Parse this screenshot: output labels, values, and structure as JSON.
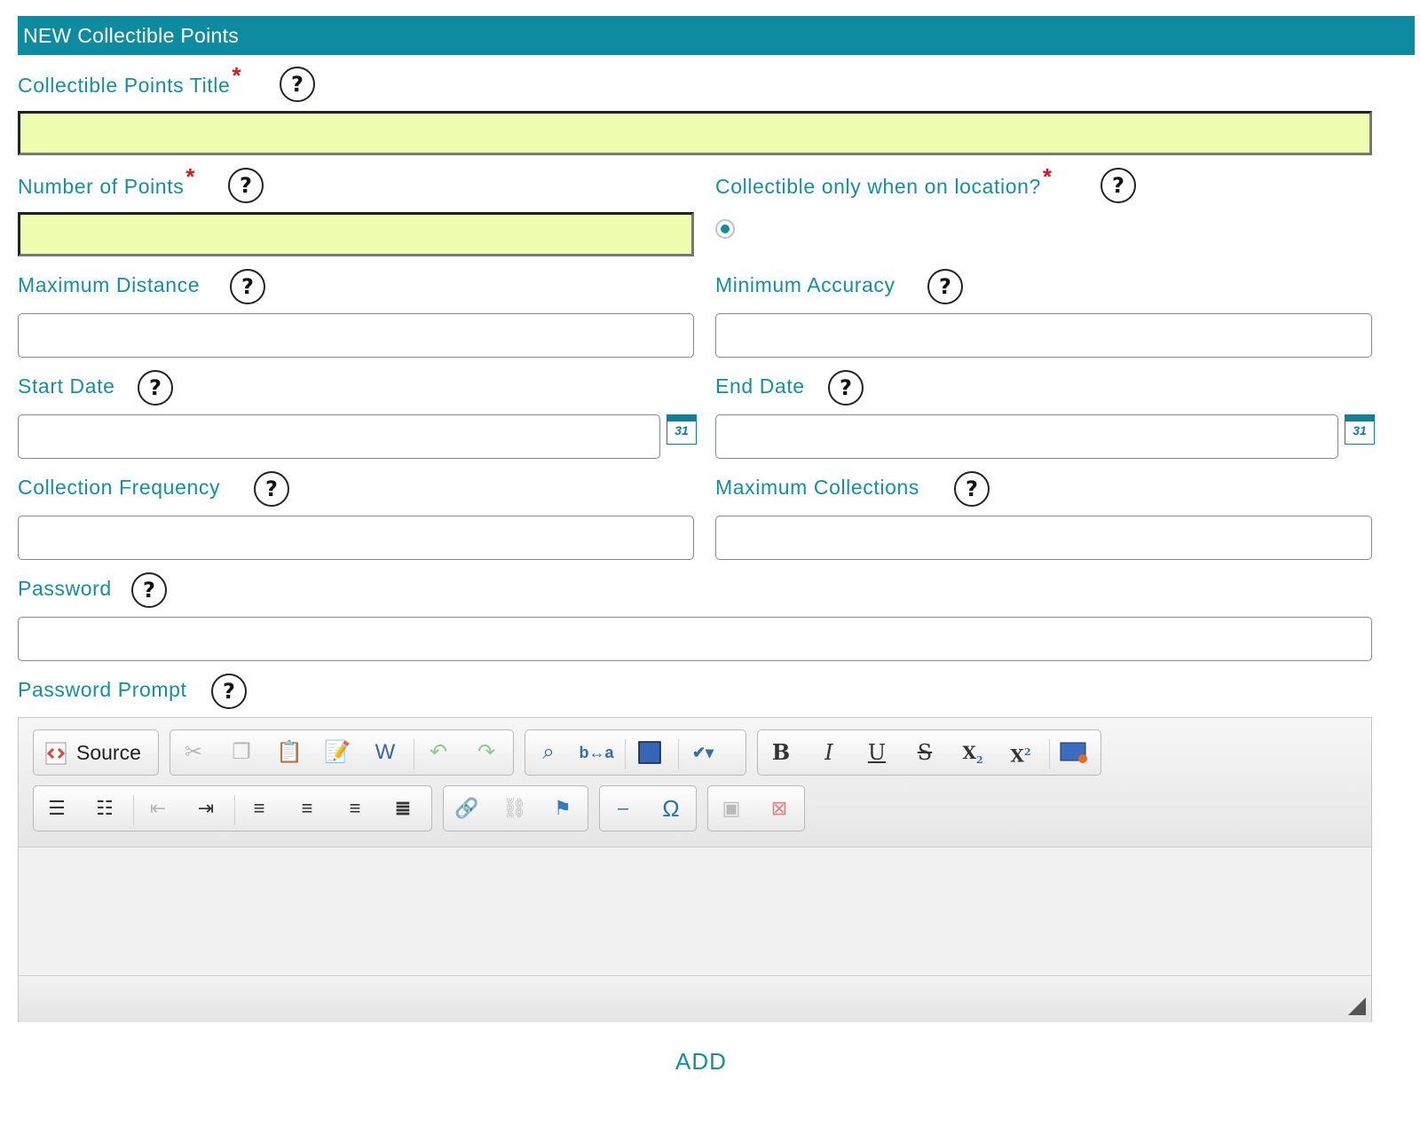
{
  "form": {
    "title": "NEW Collectible Points",
    "required_mark": "*",
    "help_symbol": "?",
    "fields": {
      "title": {
        "label": "Collectible Points Title"
      },
      "points": {
        "label": "Number of Points"
      },
      "on_location": {
        "label": "Collectible only when on location?"
      },
      "max_distance": {
        "label": "Maximum Distance"
      },
      "min_accuracy": {
        "label": "Minimum Accuracy"
      },
      "start_date": {
        "label": "Start Date"
      },
      "end_date": {
        "label": "End Date"
      },
      "frequency": {
        "label": "Collection Frequency"
      },
      "max_collections": {
        "label": "Maximum Collections"
      },
      "password": {
        "label": "Password"
      },
      "password_prompt": {
        "label": "Password Prompt"
      }
    },
    "calendar_icon_text": "31",
    "submit_label": "ADD"
  },
  "editor": {
    "source_label": "Source",
    "toolbar_row1": [
      "cut-icon",
      "copy-icon",
      "paste-icon",
      "paste-text-icon",
      "paste-word-icon",
      "undo-icon",
      "redo-icon",
      "find-icon",
      "replace-icon",
      "select-all-icon",
      "spellcheck-icon",
      "bold-icon",
      "italic-icon",
      "underline-icon",
      "strike-icon",
      "subscript-icon",
      "superscript-icon",
      "html-icon"
    ],
    "toolbar_row2": [
      "numbered-list-icon",
      "bulleted-list-icon",
      "outdent-icon",
      "indent-icon",
      "align-left-icon",
      "align-center-icon",
      "align-right-icon",
      "justify-icon",
      "link-icon",
      "unlink-icon",
      "anchor-icon",
      "horizontal-rule-icon",
      "special-char-icon",
      "image-icon",
      "remove-format-icon"
    ]
  },
  "colors": {
    "accent": "#0e8ba0",
    "required_bg": "#eefdb0",
    "required_mark": "#e0141c"
  }
}
